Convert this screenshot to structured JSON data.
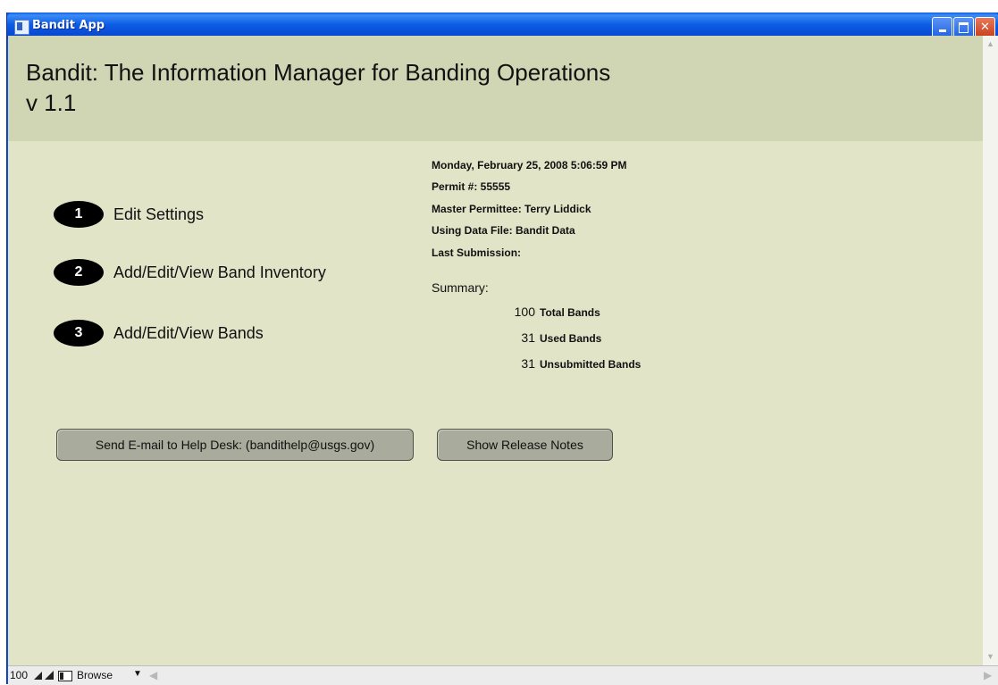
{
  "window": {
    "title": "Bandit App",
    "minimize_glyph": "",
    "close_glyph": "✕"
  },
  "header": {
    "title": "Bandit: The Information Manager for Banding Operations",
    "version": "v 1.1"
  },
  "steps": [
    {
      "number": "1",
      "label": "Edit Settings"
    },
    {
      "number": "2",
      "label": "Add/Edit/View Band Inventory"
    },
    {
      "number": "3",
      "label": "Add/Edit/View Bands"
    }
  ],
  "info": {
    "datetime": "Monday, February 25, 2008  5:06:59 PM",
    "permit": "Permit #: 55555",
    "master_permittee": "Master Permittee: Terry Liddick",
    "data_file": "Using Data File: Bandit Data",
    "last_submission": "Last Submission:"
  },
  "summary": {
    "label": "Summary:",
    "rows": [
      {
        "value": "100",
        "label": "Total Bands"
      },
      {
        "value": "31",
        "label": "Used Bands"
      },
      {
        "value": "31",
        "label": "Unsubmitted Bands"
      }
    ]
  },
  "buttons": {
    "email": "Send E-mail to Help Desk: (bandithelp@usgs.gov)",
    "release_notes": "Show Release Notes"
  },
  "statusbar": {
    "zoom": "100",
    "mode": "Browse"
  }
}
